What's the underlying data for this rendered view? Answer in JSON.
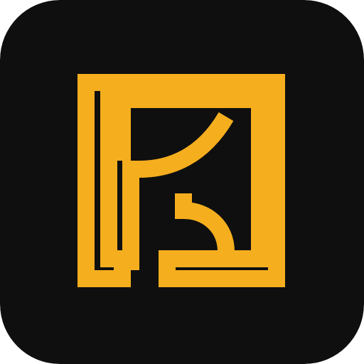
{
  "icon": {
    "name": "k-monogram-logo-icon",
    "background_color": "#0f0f0f",
    "mark_color": "#f5ae1e"
  }
}
